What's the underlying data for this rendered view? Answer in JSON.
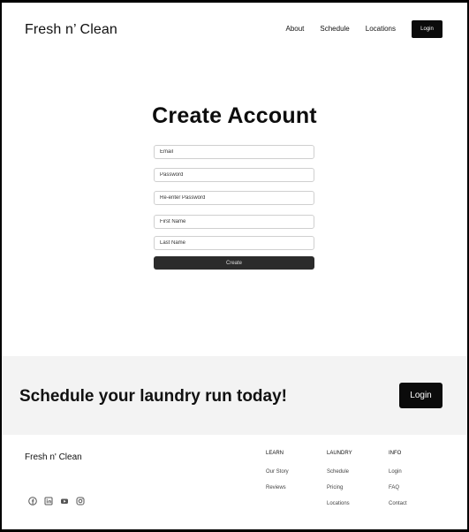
{
  "header": {
    "brand": "Fresh n’ Clean",
    "nav": [
      "About",
      "Schedule",
      "Locations"
    ],
    "login_label": "Login"
  },
  "form": {
    "title": "Create Account",
    "fields": [
      {
        "placeholder": "Email",
        "value": ""
      },
      {
        "placeholder": "Password",
        "value": ""
      },
      {
        "placeholder": "Re-enter Password",
        "value": ""
      },
      {
        "placeholder": "First Name",
        "value": ""
      },
      {
        "placeholder": "Last Name",
        "value": ""
      }
    ],
    "submit_label": "Create"
  },
  "cta": {
    "heading": "Schedule your laundry run today!",
    "button_label": "Login"
  },
  "footer": {
    "brand": "Fresh n' Clean",
    "columns": [
      {
        "heading": "LEARN",
        "links": [
          "Our Story",
          "Reviews"
        ]
      },
      {
        "heading": "LAUNDRY",
        "links": [
          "Schedule",
          "Pricing",
          "Locations"
        ]
      },
      {
        "heading": "INFO",
        "links": [
          "Login",
          "FAQ",
          "Contact"
        ]
      }
    ],
    "social_icons": [
      "facebook-icon",
      "linkedin-icon",
      "youtube-icon",
      "instagram-icon"
    ]
  },
  "colors": {
    "accent": "#0b0b0b",
    "cta_background": "#f3f3f3",
    "submit_button": "#2b2b2b"
  }
}
